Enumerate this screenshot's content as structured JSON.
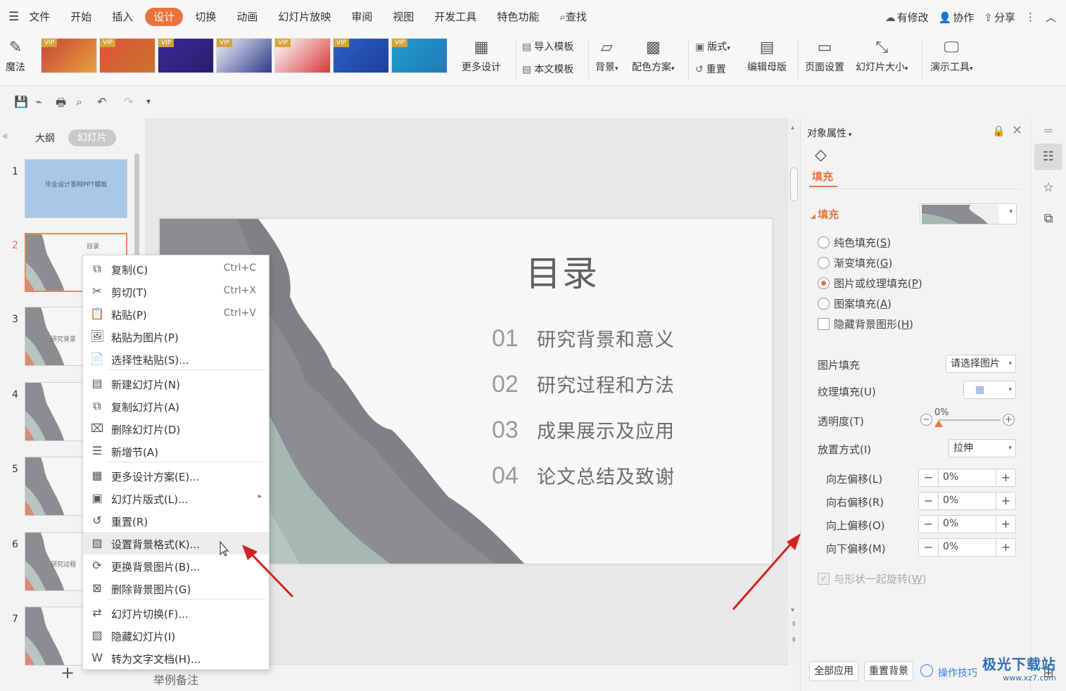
{
  "menubar": {
    "items": [
      {
        "label": "文件"
      },
      {
        "label": "开始"
      },
      {
        "label": "插入"
      },
      {
        "label": "设计",
        "active": true
      },
      {
        "label": "切换"
      },
      {
        "label": "动画"
      },
      {
        "label": "幻灯片放映"
      },
      {
        "label": "审阅"
      },
      {
        "label": "视图"
      },
      {
        "label": "开发工具"
      },
      {
        "label": "特色功能"
      },
      {
        "label": "查找"
      }
    ],
    "right": {
      "modified": "有修改",
      "collab": "协作",
      "share": "分享"
    }
  },
  "ribbon": {
    "magic": "魔法",
    "vip_badge": "VIP",
    "templates": [
      {
        "colors": [
          "#c8423a",
          "#e8a13c"
        ]
      },
      {
        "colors": [
          "#e2503a",
          "#c8752f"
        ]
      },
      {
        "colors": [
          "#3a2a9a",
          "#2b1c6e"
        ]
      },
      {
        "colors": [
          "#f2f2f2",
          "#2c3b8c"
        ]
      },
      {
        "colors": [
          "#ffffff",
          "#d63a3a"
        ]
      },
      {
        "colors": [
          "#2a62c8",
          "#1d3f9a"
        ]
      },
      {
        "colors": [
          "#1aa0c8",
          "#2578b8"
        ]
      }
    ],
    "more_design": "更多设计",
    "import_template": "导入模板",
    "this_template": "本文模板",
    "background": "背景",
    "color_scheme": "配色方案",
    "layout": "版式",
    "reset": "重置",
    "edit_master": "编辑母版",
    "page_setup": "页面设置",
    "slide_size": "幻灯片大小",
    "present_tools": "演示工具"
  },
  "left_panel": {
    "tab_outline": "大纲",
    "tab_slides": "幻灯片",
    "slides": [
      {
        "num": "1",
        "text": "毕业设计答辩PPT模板",
        "bg": "#a9c7e6"
      },
      {
        "num": "2",
        "text": "目录",
        "selected": true
      },
      {
        "num": "3",
        "text": "研究背景"
      },
      {
        "num": "4",
        "text": ""
      },
      {
        "num": "5",
        "text": ""
      },
      {
        "num": "6",
        "text": "研究过程"
      },
      {
        "num": "7",
        "text": ""
      }
    ]
  },
  "slide": {
    "title": "目录",
    "items": [
      {
        "num": "01",
        "text": "研究背景和意义"
      },
      {
        "num": "02",
        "text": "研究过程和方法"
      },
      {
        "num": "03",
        "text": "成果展示及应用"
      },
      {
        "num": "04",
        "text": "论文总结及致谢"
      }
    ]
  },
  "notes": {
    "placeholder": "举例备注"
  },
  "context_menu": {
    "items": [
      {
        "label": "复制(C)",
        "shortcut": "Ctrl+C",
        "icon": "copy-icon",
        "glyph": "⧉"
      },
      {
        "label": "剪切(T)",
        "shortcut": "Ctrl+X",
        "icon": "cut-icon",
        "glyph": "✂"
      },
      {
        "label": "粘贴(P)",
        "shortcut": "Ctrl+V",
        "icon": "paste-icon",
        "glyph": "📋"
      },
      {
        "label": "粘贴为图片(P)",
        "shortcut": "",
        "icon": "paste-image-icon",
        "glyph": "🖼"
      },
      {
        "label": "选择性粘贴(S)...",
        "shortcut": "",
        "icon": "paste-special-icon",
        "glyph": "📄"
      },
      {
        "label": "新建幻灯片(N)",
        "shortcut": "",
        "icon": "new-slide-icon",
        "glyph": "▤"
      },
      {
        "label": "复制幻灯片(A)",
        "shortcut": "",
        "icon": "duplicate-slide-icon",
        "glyph": "⧉"
      },
      {
        "label": "删除幻灯片(D)",
        "shortcut": "",
        "icon": "delete-slide-icon",
        "glyph": "⌧"
      },
      {
        "label": "新增节(A)",
        "shortcut": "",
        "icon": "new-section-icon",
        "glyph": "☰"
      },
      {
        "label": "更多设计方案(E)...",
        "shortcut": "",
        "icon": "design-icon",
        "glyph": "▦"
      },
      {
        "label": "幻灯片版式(L)...",
        "shortcut": "",
        "icon": "layout-icon",
        "glyph": "▣"
      },
      {
        "label": "重置(R)",
        "shortcut": "",
        "icon": "reset-icon",
        "glyph": "↺"
      },
      {
        "label": "设置背景格式(K)...",
        "shortcut": "",
        "icon": "background-format-icon",
        "glyph": "▨",
        "highlight": true
      },
      {
        "label": "更换背景图片(B)...",
        "shortcut": "",
        "icon": "change-bg-image-icon",
        "glyph": "⟳"
      },
      {
        "label": "删除背景图片(G)",
        "shortcut": "",
        "icon": "delete-bg-image-icon",
        "glyph": "⊠"
      },
      {
        "label": "幻灯片切换(F)...",
        "shortcut": "",
        "icon": "transition-icon",
        "glyph": "⇄"
      },
      {
        "label": "隐藏幻灯片(I)",
        "shortcut": "",
        "icon": "hide-slide-icon",
        "glyph": "▧"
      },
      {
        "label": "转为文字文档(H)...",
        "shortcut": "",
        "icon": "to-word-icon",
        "glyph": "W"
      }
    ]
  },
  "property_pane": {
    "title": "对象属性",
    "tab": "填充",
    "section": "填充",
    "fill_options": [
      {
        "label": "纯色填充",
        "key": "S",
        "selected": false
      },
      {
        "label": "渐变填充",
        "key": "G",
        "selected": false
      },
      {
        "label": "图片或纹理填充",
        "key": "P",
        "selected": true
      },
      {
        "label": "图案填充",
        "key": "A",
        "selected": false
      }
    ],
    "hide_bg_shapes": "隐藏背景图形",
    "hide_bg_shapes_key": "H",
    "picture_fill_label": "图片填充",
    "picture_fill_value": "请选择图片",
    "texture_fill_label": "纹理填充(U)",
    "transparency_label": "透明度(T)",
    "transparency_value": "0%",
    "placement_label": "放置方式(I)",
    "placement_value": "拉伸",
    "offsets": [
      {
        "label": "向左偏移(L)",
        "value": "0%"
      },
      {
        "label": "向右偏移(R)",
        "value": "0%"
      },
      {
        "label": "向上偏移(O)",
        "value": "0%"
      },
      {
        "label": "向下偏移(M)",
        "value": "0%"
      }
    ],
    "rotate_with_shape": "与形状一起旋转",
    "rotate_with_shape_key": "W",
    "apply_all": "全部应用",
    "reset_bg": "重置背景",
    "tips": "操作技巧"
  },
  "watermark": {
    "main": "极光下载站",
    "sub": "www.xz7.com"
  },
  "colors": {
    "accent": "#e8743d",
    "arrow": "#d42020"
  }
}
